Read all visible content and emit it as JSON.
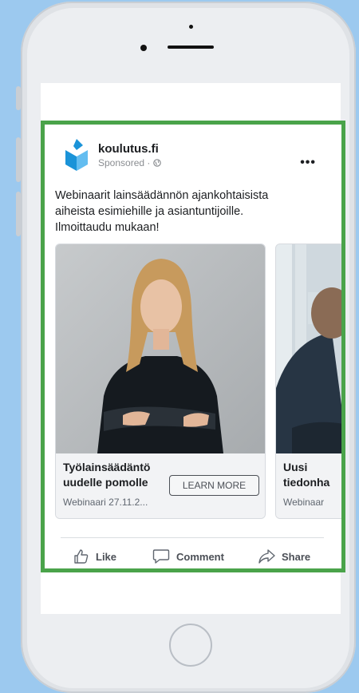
{
  "post": {
    "page_name": "koulutus.fi",
    "sponsored": "Sponsored · ",
    "text": "Webinaarit lainsäädännön ajankohtaisista\naiheista esimiehille ja asiantuntijoille.\nIlmoittaudu mukaan!"
  },
  "carousel": {
    "cards": [
      {
        "title": "Työlainsäädäntö\nuudelle pomolle",
        "subtitle": "Webinaari 27.11.2...",
        "cta": "LEARN MORE"
      },
      {
        "title": "Uusi\ntiedonha",
        "subtitle": "Webinaar"
      }
    ]
  },
  "actions": {
    "like": "Like",
    "comment": "Comment",
    "share": "Share"
  },
  "colors": {
    "background": "#9cc9ef",
    "ad_frame_border": "#4aa34a",
    "logo_blue": "#1a93d8"
  },
  "icons": {
    "logo": "book-logo-icon",
    "globe": "globe-icon",
    "more": "more-options-icon",
    "like": "thumbs-up-icon",
    "comment": "comment-bubble-icon",
    "share": "share-arrow-icon"
  }
}
